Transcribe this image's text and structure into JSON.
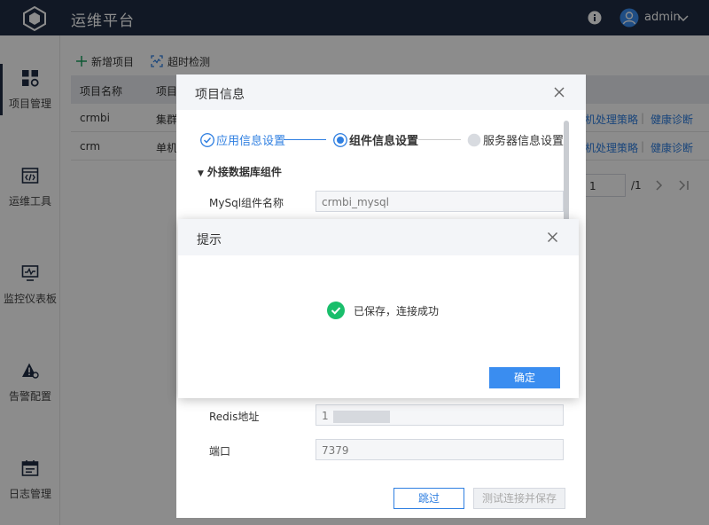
{
  "app": {
    "title": "运维平台",
    "username": "admin"
  },
  "sidebar": {
    "items": [
      {
        "label": "项目管理",
        "icon": "grid-icon"
      },
      {
        "label": "运维工具",
        "icon": "code-icon"
      },
      {
        "label": "监控仪表板",
        "icon": "monitor-icon"
      },
      {
        "label": "告警配置",
        "icon": "warning-icon"
      },
      {
        "label": "日志管理",
        "icon": "calendar-icon"
      }
    ]
  },
  "toolbar": {
    "add_label": "新增项目",
    "timeout_label": "超时检测"
  },
  "table": {
    "headers": [
      "项目名称",
      "项目"
    ],
    "rows": [
      {
        "name": "crmbi",
        "type": "集群",
        "action1": "机处理策略",
        "action2": "健康诊断"
      },
      {
        "name": "crm",
        "type": "单机",
        "action1": "机处理策略",
        "action2": "健康诊断"
      }
    ]
  },
  "pager": {
    "current": "1",
    "total": "/1"
  },
  "project_dialog": {
    "title": "项目信息",
    "steps": [
      "应用信息设置",
      "组件信息设置",
      "服务器信息设置"
    ],
    "section": "外接数据库组件",
    "fields": [
      {
        "label": "MySql组件名称",
        "value": "crmbi_mysql"
      },
      {
        "label": "Redis地址",
        "value": "1"
      },
      {
        "label": "端口",
        "value": "7379"
      }
    ],
    "skip_label": "跳过",
    "test_label": "测试连接并保存"
  },
  "prompt": {
    "title": "提示",
    "message": "已保存，连接成功",
    "ok_label": "确定"
  },
  "colors": {
    "topbar": "#1f2d44",
    "accent": "#2f7fe1",
    "success": "#19be6b",
    "primary_button": "#3a8df0"
  }
}
